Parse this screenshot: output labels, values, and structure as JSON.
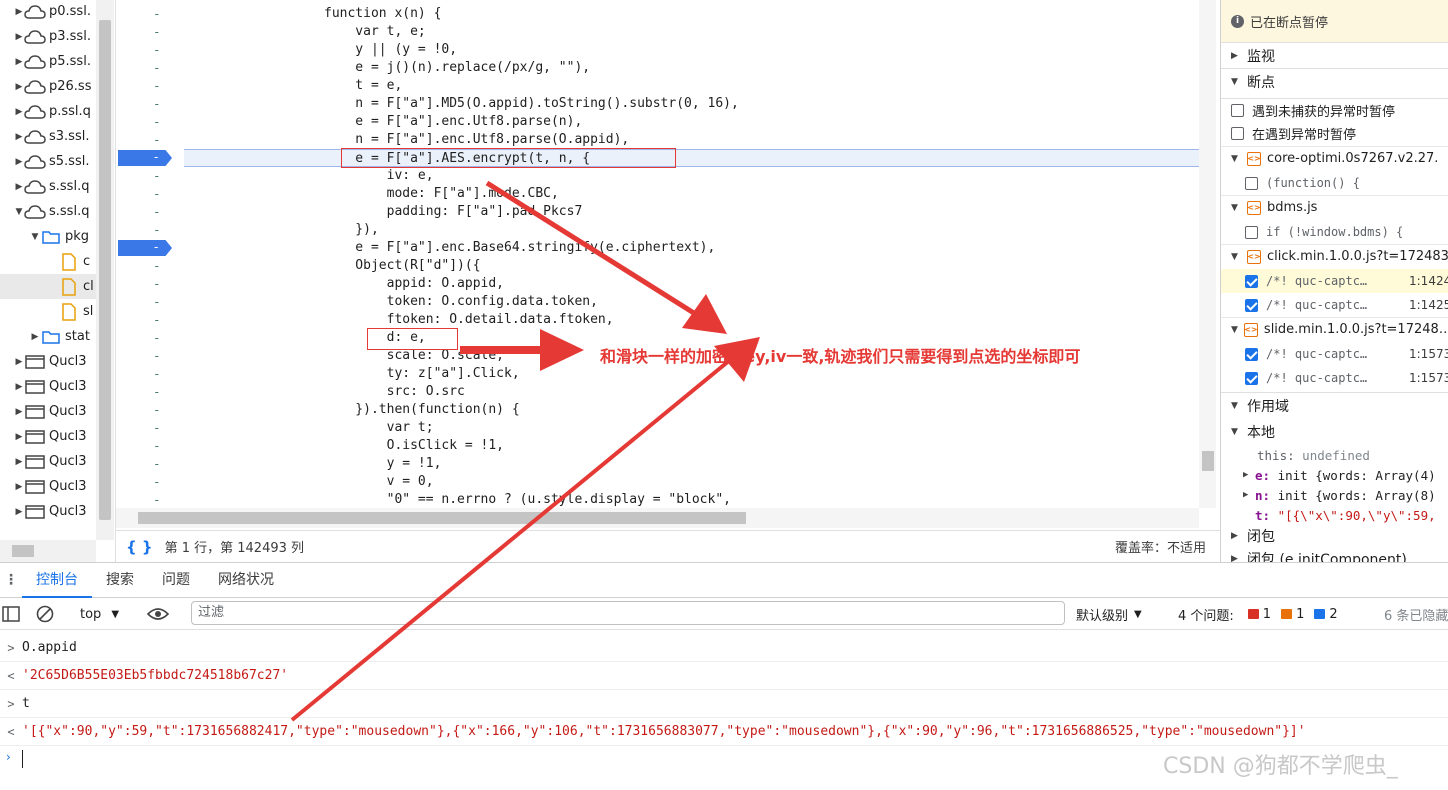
{
  "tree": {
    "items": [
      {
        "label": "p0.ssl.",
        "type": "cloud",
        "expanded": false
      },
      {
        "label": "p3.ssl.",
        "type": "cloud",
        "expanded": false
      },
      {
        "label": "p5.ssl.",
        "type": "cloud",
        "expanded": false
      },
      {
        "label": "p26.ss",
        "type": "cloud",
        "expanded": false
      },
      {
        "label": "p.ssl.q",
        "type": "cloud",
        "expanded": false
      },
      {
        "label": "s3.ssl.",
        "type": "cloud",
        "expanded": false
      },
      {
        "label": "s5.ssl.",
        "type": "cloud",
        "expanded": false
      },
      {
        "label": "s.ssl.q",
        "type": "cloud",
        "expanded": false
      },
      {
        "label": "s.ssl.q",
        "type": "cloud",
        "expanded": true
      },
      {
        "label": "pkg",
        "type": "folder",
        "expanded": true
      },
      {
        "label": "c",
        "type": "file"
      },
      {
        "label": "cl",
        "type": "file",
        "selected": true
      },
      {
        "label": "sl",
        "type": "file"
      },
      {
        "label": "stat",
        "type": "folder",
        "expanded": false
      },
      {
        "label": "Qucl3",
        "type": "frame"
      },
      {
        "label": "Qucl3",
        "type": "frame"
      },
      {
        "label": "Qucl3",
        "type": "frame"
      },
      {
        "label": "Qucl3",
        "type": "frame"
      },
      {
        "label": "Qucl3",
        "type": "frame"
      },
      {
        "label": "Qucl3",
        "type": "frame"
      },
      {
        "label": "Qucl3",
        "type": "frame"
      }
    ]
  },
  "editor": {
    "gutter_dash": "-",
    "lines": [
      "function x(n) {",
      "    var t, e;",
      "    y || (y = !0,",
      "    e = j()(n).replace(/px/g, \"\"),",
      "    t = e,",
      "    n = F[\"a\"].MD5(O.appid).toString().substr(0, 16),",
      "    e = F[\"a\"].enc.Utf8.parse(n),",
      "    n = F[\"a\"].enc.Utf8.parse(O.appid),",
      "    e = F[\"a\"].AES.encrypt(t, n, {",
      "        iv: e,",
      "        mode: F[\"a\"].mode.CBC,",
      "        padding: F[\"a\"].pad.Pkcs7",
      "    }),",
      "    e = F[\"a\"].enc.Base64.stringify(e.ciphertext),",
      "    Object(R[\"d\"])({",
      "        appid: O.appid,",
      "        token: O.config.data.token,",
      "        ftoken: O.detail.data.ftoken,",
      "        d: e,",
      "        scale: O.scale,",
      "        ty: z[\"a\"].Click,",
      "        src: O.src",
      "    }).then(function(n) {",
      "        var t;",
      "        O.isClick = !1,",
      "        y = !1,",
      "        v = 0,",
      "        \"0\" == n.errno ? (u.style.display = \"block\","
    ],
    "status_position": "第 1 行，第 142493 列",
    "status_coverage": "覆盖率：不适用"
  },
  "debugger": {
    "paused_label": "已在断点暂停",
    "watch_label": "监视",
    "breakpoints_label": "断点",
    "pause_uncaught": "遇到未捕获的异常时暂停",
    "pause_caught": "在遇到异常时暂停",
    "files": [
      {
        "name": "core-optimi.0s7267.v2.27.",
        "bps": [
          {
            "code": "(function() {",
            "loc": "",
            "checked": false
          }
        ]
      },
      {
        "name": "bdms.js",
        "bps": [
          {
            "code": "if (!window.bdms) {",
            "loc": "",
            "checked": false
          }
        ]
      },
      {
        "name": "click.min.1.0.0.js?t=172483",
        "bps": [
          {
            "code": "/*! quc-captc…",
            "loc": "1:1424",
            "checked": true,
            "active": true
          },
          {
            "code": "/*! quc-captc…",
            "loc": "1:1425",
            "checked": true
          }
        ]
      },
      {
        "name": "slide.min.1.0.0.js?t=17248…",
        "bps": [
          {
            "code": "/*! quc-captc…",
            "loc": "1:1573",
            "checked": true
          },
          {
            "code": "/*! quc-captc…",
            "loc": "1:1573",
            "checked": true
          }
        ]
      }
    ],
    "scope_label": "作用域",
    "local_label": "本地",
    "scope_this_key": "this:",
    "scope_this_val": "undefined",
    "scope_e_key": "e:",
    "scope_e_val": "init {words: Array(4)",
    "scope_n_key": "n:",
    "scope_n_val": "init {words: Array(8)",
    "scope_t_key": "t:",
    "scope_t_val": "\"[{\\\"x\\\":90,\\\"y\\\":59,",
    "closure_label": "闭包",
    "closure2_label": "闭包 (e.initComponent)"
  },
  "console": {
    "tabs": [
      "控制台",
      "搜索",
      "问题",
      "网络状况"
    ],
    "context": "top",
    "filter_placeholder": "过滤",
    "levels": "默认级别",
    "issues_label": "4 个问题:",
    "issues_red": "1",
    "issues_orange": "1",
    "issues_blue": "2",
    "hidden": "6 条已隐藏",
    "lines": [
      {
        "dir": ">",
        "text": "O.appid",
        "kind": "input"
      },
      {
        "dir": "<",
        "text": "'2C65D6B55E03Eb5fbbdc724518b67c27'",
        "kind": "output"
      },
      {
        "dir": ">",
        "text": "t",
        "kind": "input"
      },
      {
        "dir": "<",
        "text": "'[{\"x\":90,\"y\":59,\"t\":1731656882417,\"type\":\"mousedown\"},{\"x\":166,\"y\":106,\"t\":1731656883077,\"type\":\"mousedown\"},{\"x\":90,\"y\":96,\"t\":1731656886525,\"type\":\"mousedown\"}]'",
        "kind": "output"
      }
    ]
  },
  "annotation": "和滑块一样的加密,key,iv一致,轨迹我们只需要得到点选的坐标即可",
  "watermark": "CSDN @狗都不学爬虫_",
  "colors": {
    "accent": "#1a73e8",
    "annotation": "#e53935",
    "paused_bg": "#fef7e0"
  }
}
